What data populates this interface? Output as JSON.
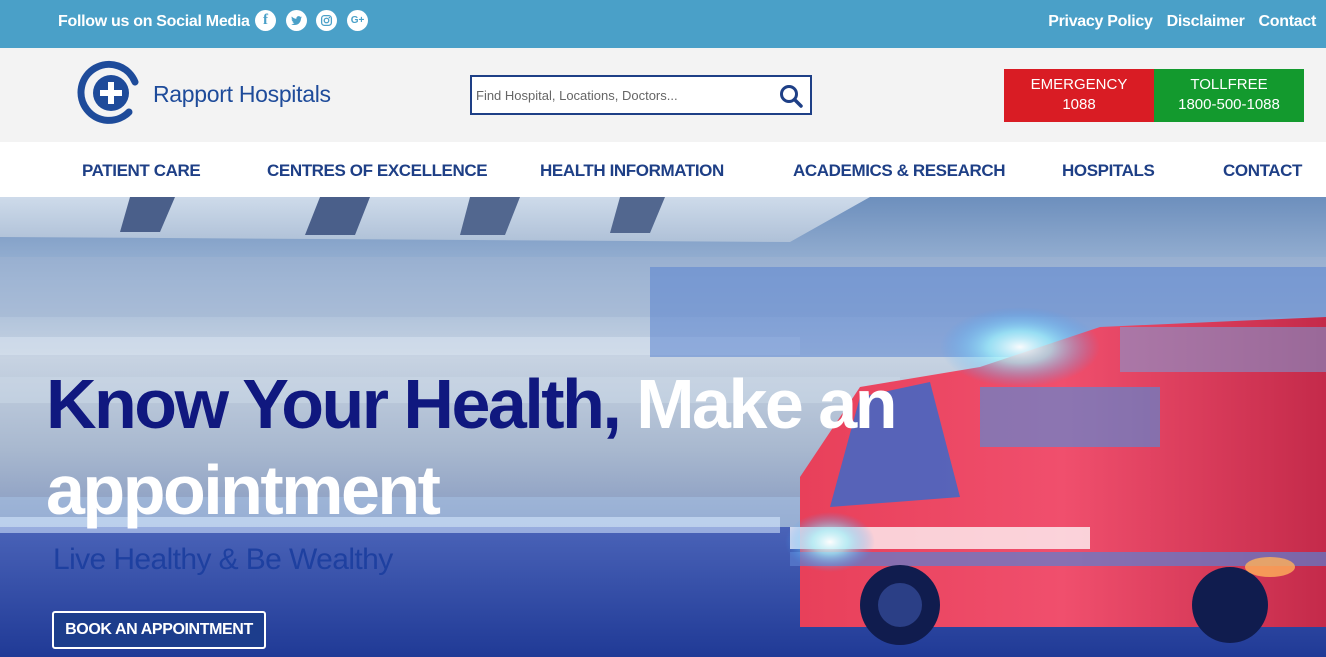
{
  "topbar": {
    "follow_label": "Follow us on Social Media",
    "social": [
      {
        "icon": "facebook-icon",
        "glyph": "f"
      },
      {
        "icon": "twitter-icon",
        "glyph": ""
      },
      {
        "icon": "instagram-icon",
        "glyph": ""
      },
      {
        "icon": "google-plus-icon",
        "glyph": "G+"
      }
    ],
    "links": [
      "Privacy Policy",
      "Disclaimer",
      "Contact"
    ]
  },
  "header": {
    "brand": "Rapport Hospitals",
    "search_placeholder": "Find Hospital, Locations, Doctors...",
    "emergency": {
      "label": "EMERGENCY",
      "number": "1088"
    },
    "tollfree": {
      "label": "TOLLFREE",
      "number": "1800-500-1088"
    }
  },
  "nav": {
    "items": [
      "PATIENT CARE",
      "CENTRES OF EXCELLENCE",
      "HEALTH INFORMATION",
      "ACADEMICS & RESEARCH",
      "HOSPITALS",
      "CONTACT"
    ]
  },
  "hero": {
    "headline_blue": "Know Your Health,",
    "headline_white": "Make an appointment",
    "tagline": "Live Healthy & Be Wealthy",
    "cta": "BOOK AN APPOINTMENT"
  },
  "colors": {
    "topbar": "#4aa0c8",
    "brand_blue": "#1e3f86",
    "emergency_red": "#d91c24",
    "tollfree_green": "#139a2e",
    "headline_blue": "#10187f"
  }
}
